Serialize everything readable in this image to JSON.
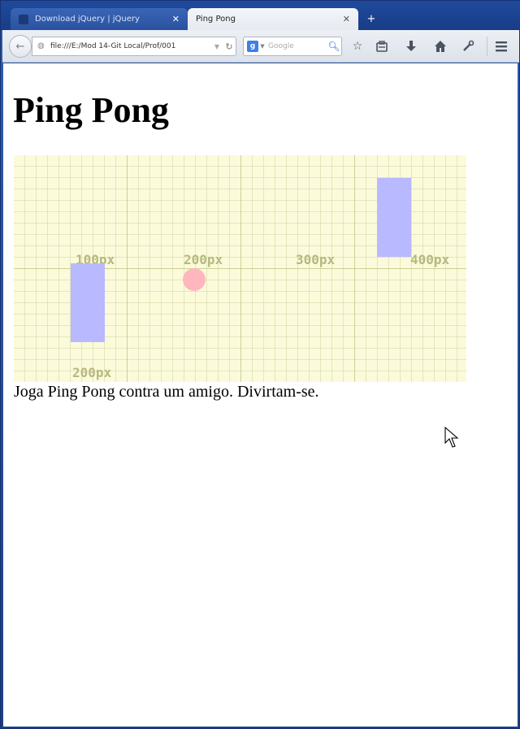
{
  "browser": {
    "tabs": [
      {
        "title": "Download jQuery | jQuery",
        "active": false,
        "close": "✕"
      },
      {
        "title": "Ping Pong",
        "active": true,
        "close": "✕"
      }
    ],
    "new_tab_icon": "+",
    "back_icon": "←",
    "url": "file:///E:/Mod 14-Git Local/Prof/001",
    "reload_icon": "↻",
    "search_engine_icon": "g",
    "search_placeholder": "Google",
    "toolbar_icons": [
      "star-icon",
      "clipboard-icon",
      "download-icon",
      "home-icon",
      "tools-icon",
      "menu-icon"
    ]
  },
  "page": {
    "heading": "Ping Pong",
    "description": "Joga Ping Pong contra um amigo. Divirtam-se.",
    "grid_labels": {
      "x100": "100px",
      "x200": "200px",
      "x300": "300px",
      "x400": "400px",
      "y200": "200px"
    }
  },
  "colors": {
    "court_background": "#fbfbdb",
    "paddle": "#b9b9ff",
    "ball": "#ffb6be",
    "grid_label": "#b7b980"
  }
}
